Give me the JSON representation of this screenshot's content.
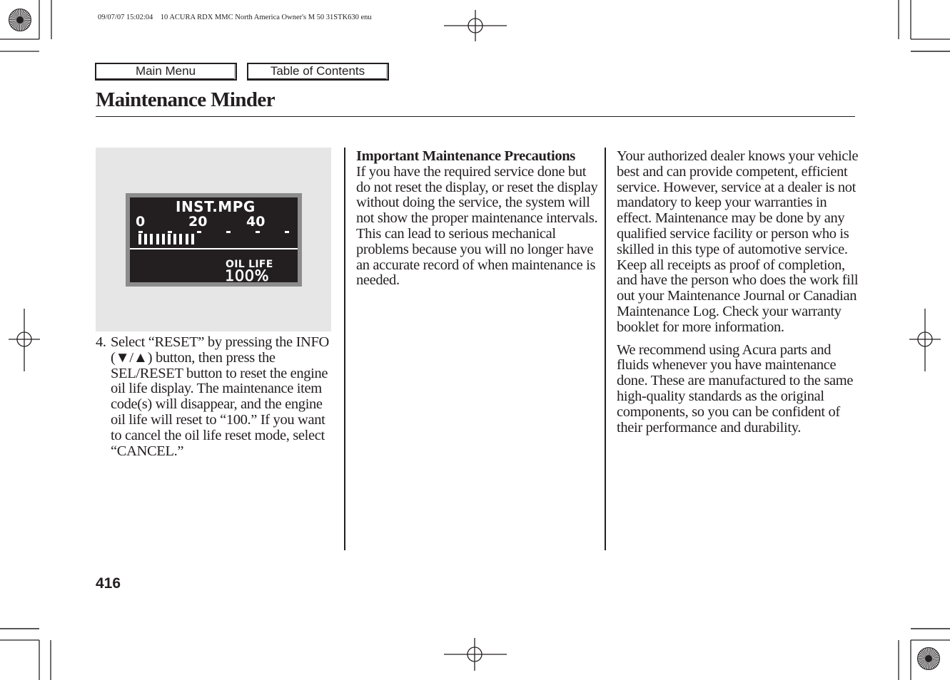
{
  "print_header": {
    "timestamp": "09/07/07 15:02:04",
    "document_id": "10 ACURA RDX MMC North America Owner's M 50 31STK630 enu"
  },
  "nav": {
    "main_menu_label": "Main Menu",
    "table_of_contents_label": "Table of Contents"
  },
  "page": {
    "title": "Maintenance Minder",
    "number": "416"
  },
  "figure": {
    "display_title": "INST.MPG",
    "scale_labels": [
      "0",
      "20",
      "40"
    ],
    "scale_tick_count": 6,
    "inst_mpg_bar_segments_lit": 10,
    "inst_mpg_reading_approx": 20,
    "oil_life_label": "OIL LIFE",
    "oil_life_value": "100%"
  },
  "column1": {
    "step_number": "4.",
    "step_text": "Select “RESET” by pressing the INFO (▼/▲) button, then press the SEL/RESET button to reset the engine oil life display. The maintenance item code(s) will disappear, and the engine oil life will reset to “100.” If you want to cancel the oil life reset mode, select “CANCEL.”"
  },
  "column2": {
    "heading": "Important Maintenance Precautions",
    "body": "If you have the required service done but do not reset the display, or reset the display without doing the service, the system will not show the proper maintenance intervals. This can lead to serious mechanical problems because you will no longer have an accurate record of when maintenance is needed."
  },
  "column3": {
    "paragraphs": [
      "Your authorized dealer knows your vehicle best and can provide competent, efficient service. However, service at a dealer is not mandatory to keep your warranties in effect. Maintenance may be done by any qualified service facility or person who is skilled in this type of automotive service. Keep all receipts as proof of completion, and have the person who does the work fill out your Maintenance Journal or Canadian Maintenance Log. Check your warranty booklet for more information.",
      "We recommend using Acura parts and fluids whenever you have maintenance done. These are manufactured to the same high-quality standards as the original components, so you can be confident of their performance and durability."
    ]
  }
}
